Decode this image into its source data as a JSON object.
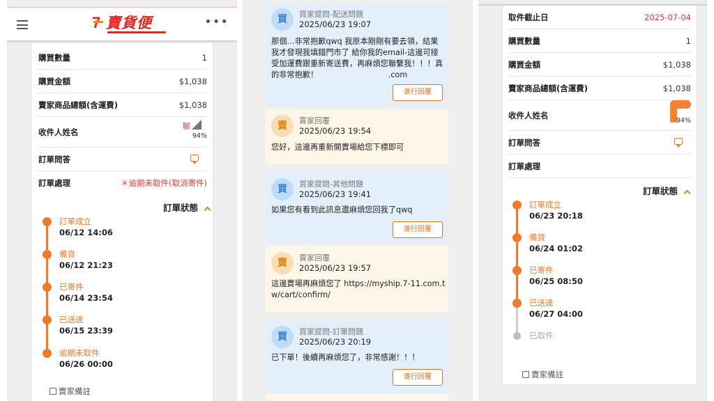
{
  "colors": {
    "accent": "#f07a2a",
    "brand_red": "#e5231b",
    "alert_red": "#e4393c",
    "buyer_bg": "#e3f0fb",
    "seller_bg": "#fdf6e9"
  },
  "panel1": {
    "header": {
      "brand_name": "賣貨便",
      "brand_mark": "7",
      "menu_icon": "hamburger-icon",
      "more_icon": "more-dots-icon",
      "more_glyph": "•••"
    },
    "rows": [
      {
        "label": "購買數量",
        "value": "1"
      },
      {
        "label": "購買金額",
        "value": "$1,038"
      },
      {
        "label": "賣家商品總額(含運費)",
        "value": "$1,038"
      },
      {
        "label": "收件人姓名",
        "value": ""
      },
      {
        "label": "訂單問答",
        "value": ""
      },
      {
        "label": "訂單處理",
        "value": "＊逾期未取件(取消寄件)"
      }
    ],
    "partial_glyph": "郰",
    "progress_percent": "94%",
    "status_title": "訂單狀態",
    "timeline": [
      {
        "name": "訂單成立",
        "time": "06/12 14:06"
      },
      {
        "name": "備貨",
        "time": "06/12 21:23"
      },
      {
        "name": "已寄件",
        "time": "06/14 23:54"
      },
      {
        "name": "已送達",
        "time": "06/15 23:39"
      },
      {
        "name": "逾期未取件",
        "time": "06/26 00:00"
      }
    ],
    "remark_label": "賣家備註"
  },
  "panel2": {
    "messages": [
      {
        "role": "buyer",
        "avatar": "買",
        "type": "買家提問-配送問題",
        "time": "2025/06/23 19:07",
        "body": "那個…非常抱歉qwq 我原本剛剛有要去領，結果我才發現我填錯門市了 給你我的email-這邊可接受加運費跟重新寄送費，再麻煩您聯繫我！！！真的非常抱歉！　　　　　　　　　.com",
        "button": "進行回覆"
      },
      {
        "role": "seller",
        "avatar": "賣",
        "type": "賣家回覆",
        "time": "2025/06/23 19:54",
        "body": "您好，這邊再重新開賣場給您下標即可",
        "button": ""
      },
      {
        "role": "buyer",
        "avatar": "買",
        "type": "買家提問-其他問題",
        "time": "2025/06/23 19:41",
        "body": "如果您有看到此訊息還麻煩您回我了qwq",
        "button": "進行回覆"
      },
      {
        "role": "seller",
        "avatar": "賣",
        "type": "賣家回覆",
        "time": "2025/06/23 19:57",
        "body": "這邊賣場再麻煩您了 https://myship.7-11.com.tw/cart/confirm/",
        "button": ""
      },
      {
        "role": "buyer",
        "avatar": "買",
        "type": "買家提問-訂單問題",
        "time": "2025/06/23 20:19",
        "body": "已下單！後續再麻煩您了，非常感謝！！！",
        "button": "進行回覆"
      }
    ]
  },
  "panel3": {
    "rows": [
      {
        "label": "取件截止日",
        "value": "2025-07-04"
      },
      {
        "label": "購買數量",
        "value": "1"
      },
      {
        "label": "購買金額",
        "value": "$1,038"
      },
      {
        "label": "賣家商品總額(含運費)",
        "value": "$1,038"
      },
      {
        "label": "收件人姓名",
        "value": ""
      },
      {
        "label": "訂單問答",
        "value": ""
      },
      {
        "label": "訂單處理",
        "value": ""
      }
    ],
    "progress_percent": "94%",
    "status_title": "訂單狀態",
    "timeline": [
      {
        "name": "訂單成立",
        "time": "06/23 20:18"
      },
      {
        "name": "備貨",
        "time": "06/24 01:02"
      },
      {
        "name": "已寄件",
        "time": "06/25 08:50"
      },
      {
        "name": "已送達",
        "time": "06/27 04:00"
      },
      {
        "name": "已取件",
        "time": ""
      }
    ],
    "remark_label": "賣家備註"
  }
}
